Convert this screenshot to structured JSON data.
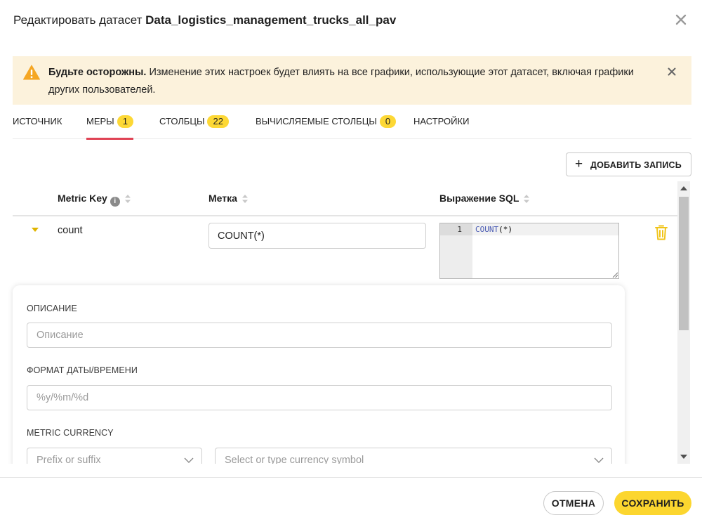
{
  "header": {
    "title_prefix": "Редактировать датасет ",
    "dataset_name": "Data_logistics_management_trucks_all_pav"
  },
  "warning": {
    "bold": "Будьте осторожны.",
    "text": " Изменение этих настроек будет влиять на все графики, использующие этот датасет, включая графики других пользователей."
  },
  "tabs": [
    {
      "label": "ИСТОЧНИК",
      "count": null
    },
    {
      "label": "МЕРЫ",
      "count": "1",
      "active": true
    },
    {
      "label": "СТОЛБЦЫ",
      "count": "22"
    },
    {
      "label": "ВЫЧИСЛЯЕМЫЕ СТОЛБЦЫ",
      "count": "0"
    },
    {
      "label": "НАСТРОЙКИ",
      "count": null
    }
  ],
  "add_button": {
    "icon": "+",
    "label": "ДОБАВИТЬ ЗАПИСЬ"
  },
  "table": {
    "columns": {
      "metric_key": "Metric Key",
      "label": "Метка",
      "sql": "Выражение SQL"
    },
    "info_glyph": "i",
    "row": {
      "metric_key": "count",
      "label": "COUNT(*)",
      "sql_line_number": "1",
      "sql_keyword": "COUNT",
      "sql_rest": "(*)"
    }
  },
  "details": {
    "description_label": "Описание",
    "description_placeholder": "Описание",
    "datetime_label": "Формат даты/времени",
    "datetime_placeholder": "%y/%m/%d",
    "currency_label": "Metric currency",
    "currency_position_placeholder": "Prefix or suffix",
    "currency_symbol_placeholder": "Select or type currency symbol"
  },
  "footer": {
    "cancel_label": "ОТМЕНА",
    "save_label": "СОХРАНИТЬ"
  },
  "colors": {
    "accent": "#fcd62f",
    "active_tab": "#e04355",
    "warning_bg": "#fcf2dc",
    "warning_icon": "#f5a623"
  }
}
